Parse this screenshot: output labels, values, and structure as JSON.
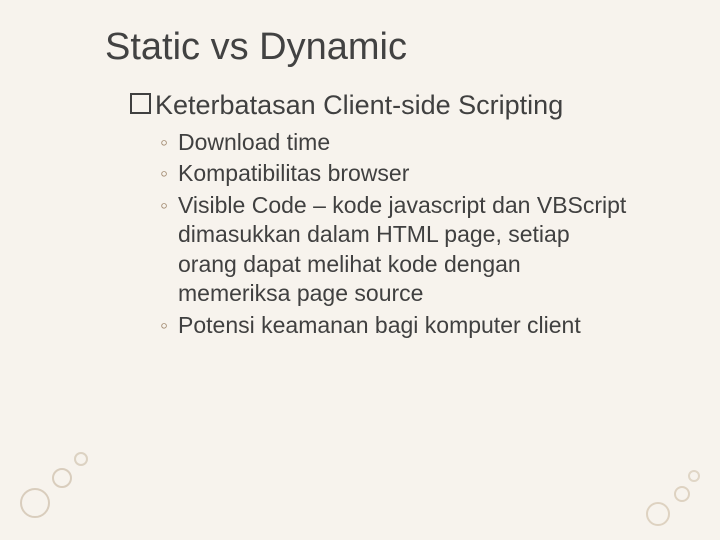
{
  "title": "Static vs Dynamic",
  "subtitle": "Keterbatasan Client-side Scripting",
  "bullets": [
    "Download time",
    "Kompatibilitas browser",
    "Visible Code – kode javascript dan VBScript dimasukkan dalam HTML page, setiap orang dapat melihat kode dengan memeriksa page source",
    "Potensi keamanan bagi komputer client"
  ],
  "bullet_marker": "◦"
}
